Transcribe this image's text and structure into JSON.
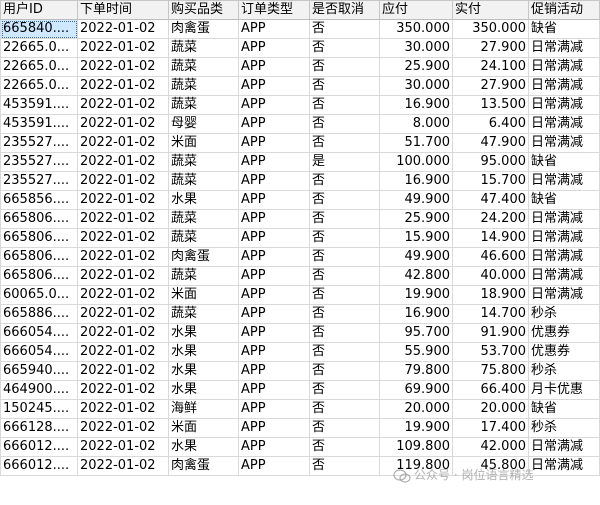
{
  "columns": [
    "用户ID",
    "下单时间",
    "购买品类",
    "订单类型",
    "是否取消",
    "应付",
    "实付",
    "促销活动"
  ],
  "rows": [
    [
      "665840....",
      "2022-01-02",
      "肉禽蛋",
      "APP",
      "否",
      "350.000",
      "350.000",
      "缺省"
    ],
    [
      "22665.0...",
      "2022-01-02",
      "蔬菜",
      "APP",
      "否",
      "30.000",
      "27.900",
      "日常满减"
    ],
    [
      "22665.0...",
      "2022-01-02",
      "蔬菜",
      "APP",
      "否",
      "25.900",
      "24.100",
      "日常满减"
    ],
    [
      "22665.0...",
      "2022-01-02",
      "蔬菜",
      "APP",
      "否",
      "30.000",
      "27.900",
      "日常满减"
    ],
    [
      "453591....",
      "2022-01-02",
      "蔬菜",
      "APP",
      "否",
      "16.900",
      "13.500",
      "日常满减"
    ],
    [
      "453591....",
      "2022-01-02",
      "母婴",
      "APP",
      "否",
      "8.000",
      "6.400",
      "日常满减"
    ],
    [
      "235527....",
      "2022-01-02",
      "米面",
      "APP",
      "否",
      "51.700",
      "47.900",
      "日常满减"
    ],
    [
      "235527....",
      "2022-01-02",
      "蔬菜",
      "APP",
      "是",
      "100.000",
      "95.000",
      "缺省"
    ],
    [
      "235527....",
      "2022-01-02",
      "蔬菜",
      "APP",
      "否",
      "16.900",
      "15.700",
      "日常满减"
    ],
    [
      "665856....",
      "2022-01-02",
      "水果",
      "APP",
      "否",
      "49.900",
      "47.400",
      "缺省"
    ],
    [
      "665806....",
      "2022-01-02",
      "蔬菜",
      "APP",
      "否",
      "25.900",
      "24.200",
      "日常满减"
    ],
    [
      "665806....",
      "2022-01-02",
      "蔬菜",
      "APP",
      "否",
      "15.900",
      "14.900",
      "日常满减"
    ],
    [
      "665806....",
      "2022-01-02",
      "肉禽蛋",
      "APP",
      "否",
      "49.900",
      "46.600",
      "日常满减"
    ],
    [
      "665806....",
      "2022-01-02",
      "蔬菜",
      "APP",
      "否",
      "42.800",
      "40.000",
      "日常满减"
    ],
    [
      "60065.0...",
      "2022-01-02",
      "米面",
      "APP",
      "否",
      "19.900",
      "18.900",
      "日常满减"
    ],
    [
      "665886....",
      "2022-01-02",
      "蔬菜",
      "APP",
      "否",
      "16.900",
      "14.700",
      "秒杀"
    ],
    [
      "666054....",
      "2022-01-02",
      "水果",
      "APP",
      "否",
      "95.700",
      "91.900",
      "优惠券"
    ],
    [
      "666054....",
      "2022-01-02",
      "水果",
      "APP",
      "否",
      "55.900",
      "53.700",
      "优惠券"
    ],
    [
      "665940....",
      "2022-01-02",
      "水果",
      "APP",
      "否",
      "79.800",
      "75.800",
      "秒杀"
    ],
    [
      "464900....",
      "2022-01-02",
      "水果",
      "APP",
      "否",
      "69.900",
      "66.400",
      "月卡优惠"
    ],
    [
      "150245....",
      "2022-01-02",
      "海鲜",
      "APP",
      "否",
      "20.000",
      "20.000",
      "缺省"
    ],
    [
      "666128....",
      "2022-01-02",
      "米面",
      "APP",
      "否",
      "19.900",
      "17.400",
      "秒杀"
    ],
    [
      "666012....",
      "2022-01-02",
      "水果",
      "APP",
      "否",
      "109.800",
      "42.000",
      "日常满减"
    ],
    [
      "666012....",
      "2022-01-02",
      "肉禽蛋",
      "APP",
      "否",
      "119.800",
      "45.800",
      "日常满减"
    ]
  ],
  "watermark": "公众号 · 岗位语言精选",
  "colors": {
    "header_bg": "#f2f2f2",
    "grid_line": "#d9d9d9",
    "selected_cell": "#cde8ff"
  }
}
